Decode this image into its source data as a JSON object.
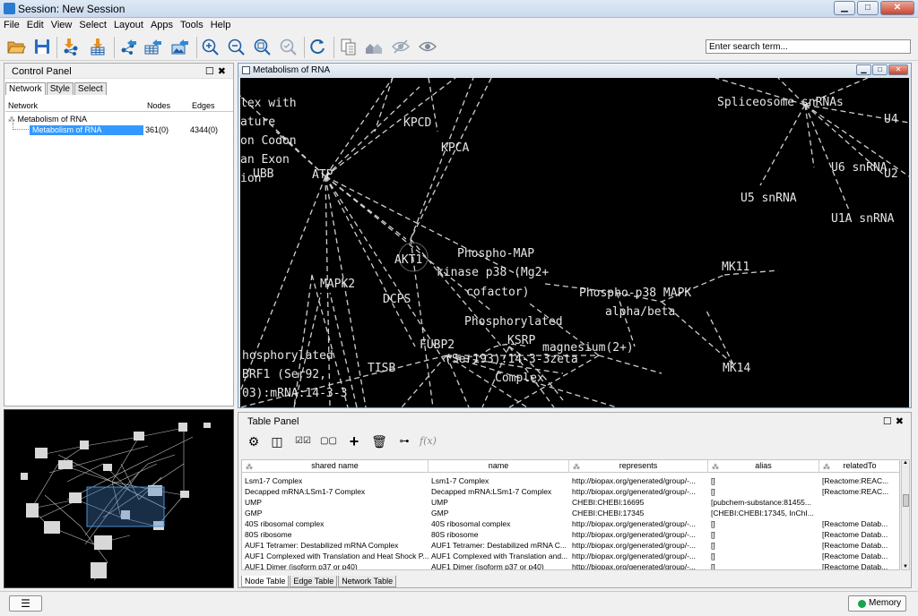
{
  "window": {
    "title": "Session: New Session",
    "minimize": "▁",
    "maximize": "□",
    "close": "✕"
  },
  "menu": [
    "File",
    "Edit",
    "View",
    "Select",
    "Layout",
    "Apps",
    "Tools",
    "Help"
  ],
  "search": {
    "placeholder": "Enter search term..."
  },
  "control_panel": {
    "title": "Control Panel",
    "tabs": [
      "Network",
      "Style",
      "Select"
    ],
    "columns": [
      "Network",
      "Nodes",
      "Edges"
    ],
    "root": "Metabolism of RNA",
    "child": {
      "name": "Metabolism of RNA",
      "nodes": "361(0)",
      "edges": "4344(0)"
    }
  },
  "network_view": {
    "title": "Metabolism of RNA",
    "labels": [
      "lex with",
      "ature",
      "on Codon",
      "an Exon",
      "ion",
      "UBB",
      "ATP",
      "KPCD",
      "KPCA",
      "Spliceosome snRNAs",
      "U4",
      "U6 snRNA",
      "U2",
      "U5 snRNA",
      "U1A snRNA",
      "AKT1",
      "Phospho-MAP",
      "kinase p38 (Mg2+",
      "cofactor)",
      "MK11",
      "Phospho-p38 MAPK",
      "alpha/beta",
      "MAPK2",
      "DCPS",
      "Phosphorylated",
      "KSRP",
      "magnesium(2+)",
      "FUBP2",
      "(Ser193):14-3-3zeta",
      "MK14",
      "hosphorylated",
      "BRF1 (Ser92,",
      "TISB",
      "Complex",
      "03):mRNA:14-3-3"
    ]
  },
  "table_panel": {
    "title": "Table Panel",
    "columns": [
      "shared name",
      "name",
      "represents",
      "alias",
      "relatedTo"
    ],
    "rows": [
      [
        "Lsm1-7 Complex",
        "Lsm1-7 Complex",
        "http://biopax.org/generated/group/-...",
        "[]",
        "[Reactome:REAC..."
      ],
      [
        "Decapped mRNA:LSm1-7 Complex",
        "Decapped mRNA:LSm1-7 Complex",
        "http://biopax.org/generated/group/-...",
        "[]",
        "[Reactome:REAC..."
      ],
      [
        "UMP",
        "UMP",
        "CHEBI:CHEBI:16695",
        "[pubchem-substance:81455...",
        ""
      ],
      [
        "GMP",
        "GMP",
        "CHEBI:CHEBI:17345",
        "[CHEBI:CHEBI:17345, InChI...",
        ""
      ],
      [
        "40S ribosomal complex",
        "40S ribosomal complex",
        "http://biopax.org/generated/group/-...",
        "[]",
        "[Reactome Datab..."
      ],
      [
        "80S ribosome",
        "80S ribosome",
        "http://biopax.org/generated/group/-...",
        "[]",
        "[Reactome Datab..."
      ],
      [
        "AUF1 Tetramer: Destabilized mRNA Complex",
        "AUF1 Tetramer: Destabilized mRNA C...",
        "http://biopax.org/generated/group/-...",
        "[]",
        "[Reactome Datab..."
      ],
      [
        "AUF1 Complexed with Translation and Heat Shock P...",
        "AUF1 Complexed with Translation and...",
        "http://biopax.org/generated/group/-...",
        "[]",
        "[Reactome Datab..."
      ],
      [
        "AUF1 Dimer (isoform p37 or p40)",
        "AUF1 Dimer (isoform p37 or p40)",
        "http://biopax.org/generated/group/-...",
        "[]",
        "[Reactome Datab..."
      ]
    ],
    "tabs": [
      "Node Table",
      "Edge Table",
      "Network Table"
    ]
  },
  "statusbar": {
    "memory": "Memory"
  }
}
